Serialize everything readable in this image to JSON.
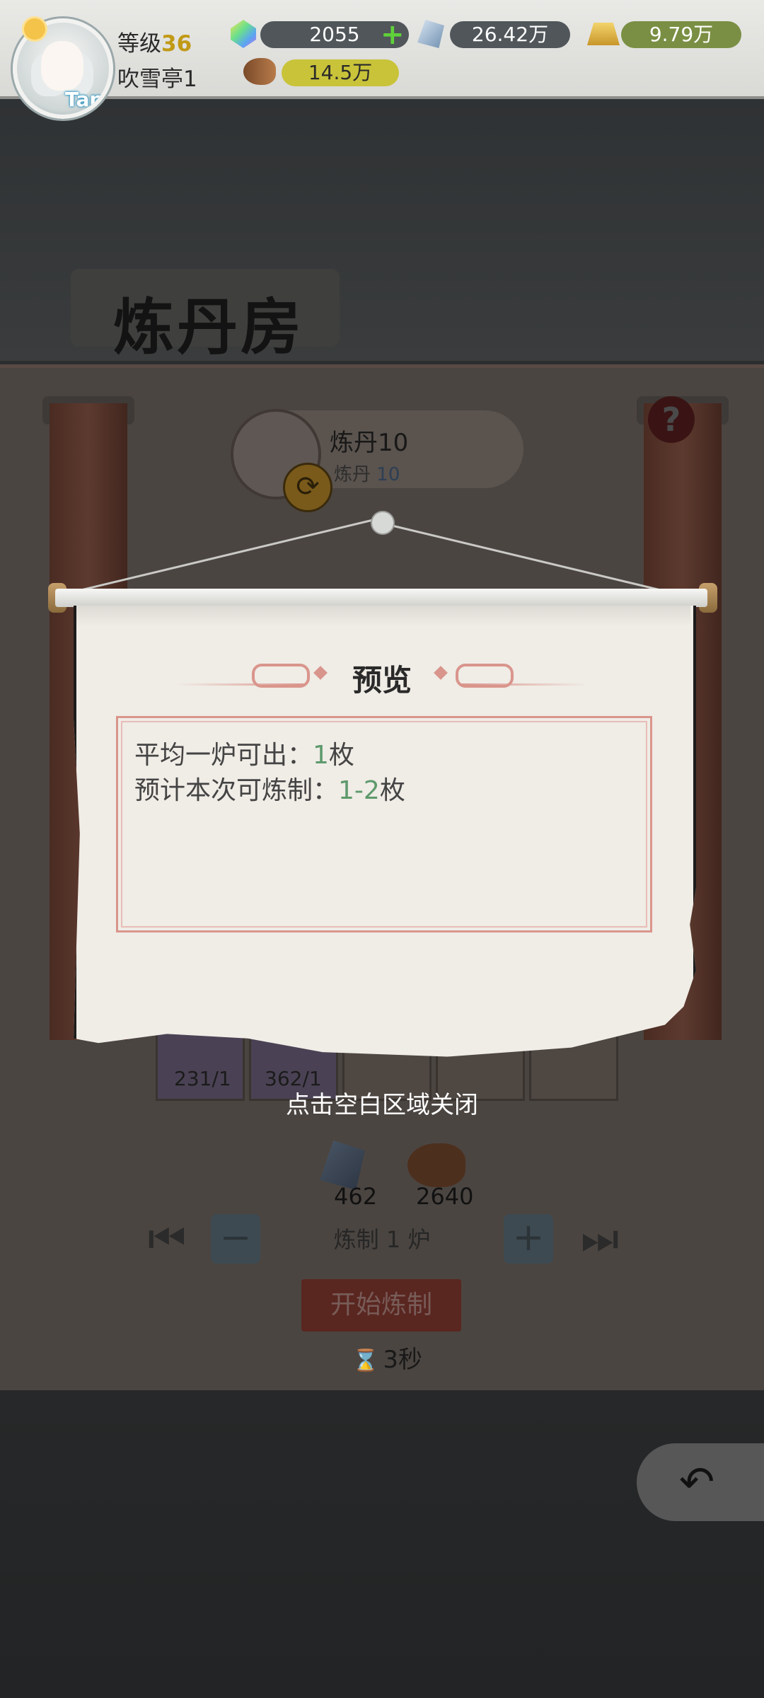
{
  "hud": {
    "level_label": "等级",
    "level_value": "36",
    "player_name": "吹雪亭1",
    "tap_badge": "Tap",
    "gems": "2055",
    "crystal": "26.42万",
    "gold": "9.79万",
    "wood": "14.5万"
  },
  "scene": {
    "title": "炼丹房",
    "worker": {
      "name": "炼丹10",
      "sub_label": "炼丹",
      "sub_value": "10"
    },
    "help": "?",
    "slots": [
      {
        "count": "231/1"
      },
      {
        "count": "362/1"
      }
    ],
    "costs": {
      "crystal": "462",
      "wood": "2640"
    },
    "craft_count": "炼制 1 炉",
    "start_button": "开始炼制",
    "timer": "3秒"
  },
  "modal": {
    "title": "预览",
    "line1_label": "平均一炉可出：",
    "line1_value": "1",
    "line1_unit": "枚",
    "line2_label": "预计本次可炼制：",
    "line2_value": "1-2",
    "line2_unit": "枚",
    "close_hint": "点击空白区域关闭"
  },
  "icons": [
    "sun-icon",
    "gem-icon",
    "plus-icon",
    "crystal-icon",
    "gold-bar-icon",
    "wood-icon",
    "swap-icon",
    "help-icon",
    "hourglass-icon",
    "return-icon"
  ],
  "colors": {
    "accent_red": "#d9958c",
    "value_green": "#5e9a6c",
    "level_gold": "#c19a16"
  }
}
